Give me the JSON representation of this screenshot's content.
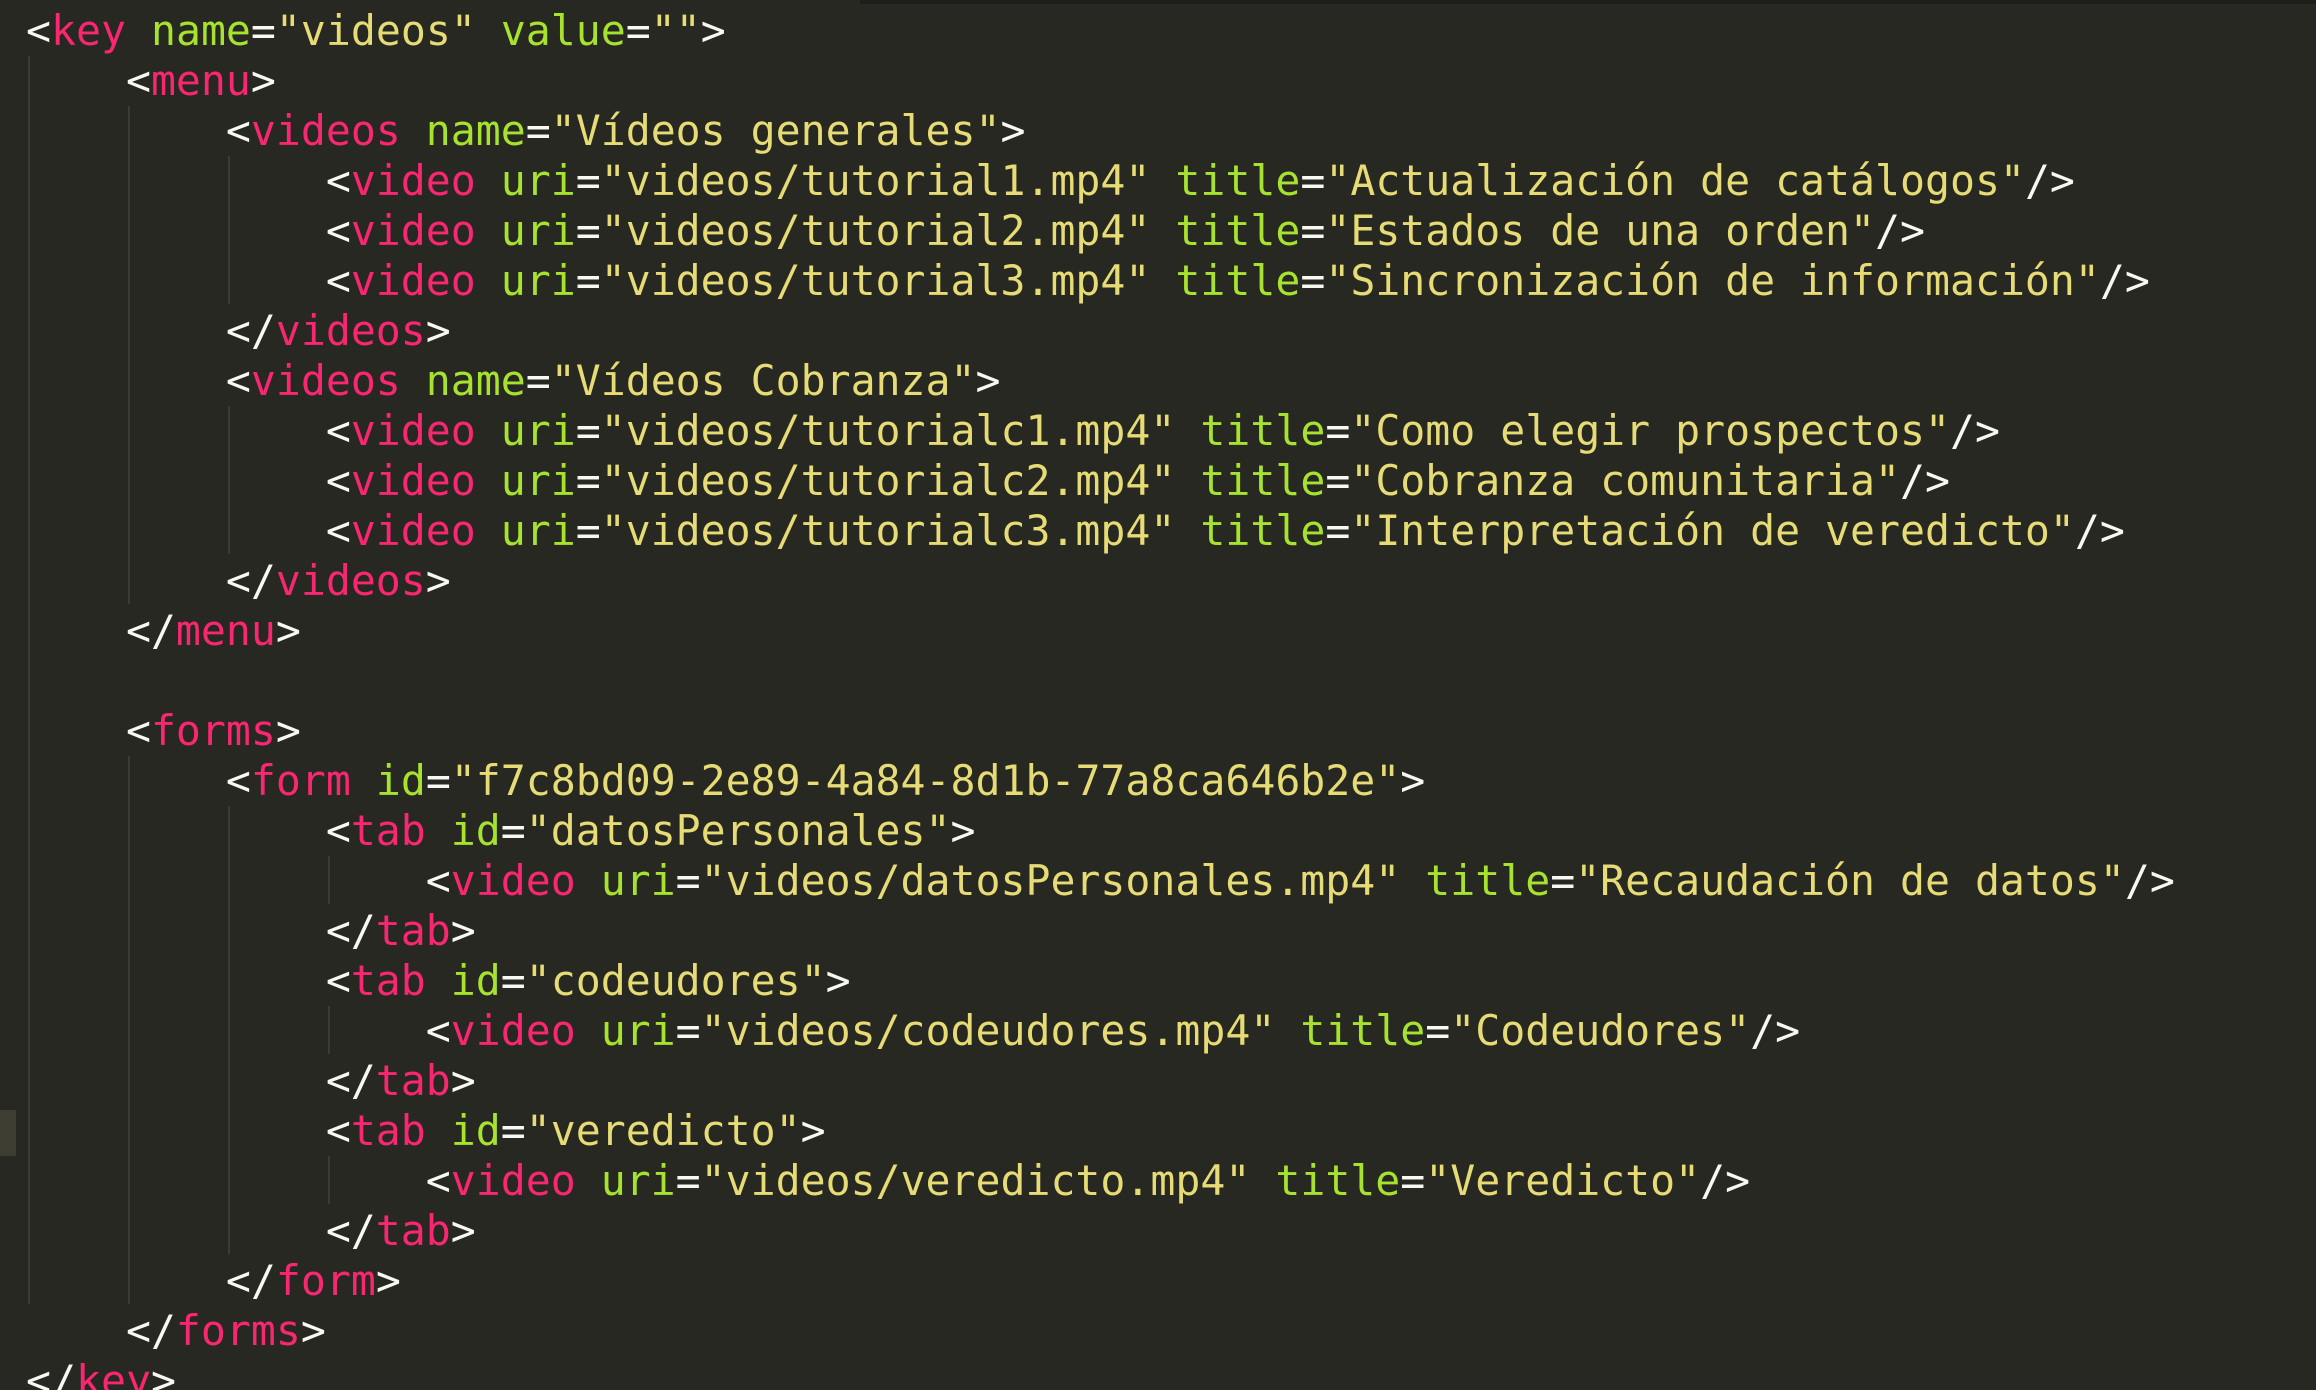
{
  "editor": {
    "theme_colors": {
      "background": "#272822",
      "tag": "#f92672",
      "attribute": "#a6e22e",
      "string": "#e6db74",
      "punctuation": "#f8f8f2"
    },
    "lines": [
      [
        {
          "k": "p",
          "v": "<"
        },
        {
          "k": "t",
          "v": "key"
        },
        {
          "k": "p",
          "v": " "
        },
        {
          "k": "a",
          "v": "name"
        },
        {
          "k": "p",
          "v": "="
        },
        {
          "k": "s",
          "v": "\"videos\""
        },
        {
          "k": "p",
          "v": " "
        },
        {
          "k": "a",
          "v": "value"
        },
        {
          "k": "p",
          "v": "="
        },
        {
          "k": "s",
          "v": "\"\""
        },
        {
          "k": "p",
          "v": ">"
        }
      ],
      [
        {
          "k": "p",
          "v": "    <"
        },
        {
          "k": "t",
          "v": "menu"
        },
        {
          "k": "p",
          "v": ">"
        }
      ],
      [
        {
          "k": "p",
          "v": "        <"
        },
        {
          "k": "t",
          "v": "videos"
        },
        {
          "k": "p",
          "v": " "
        },
        {
          "k": "a",
          "v": "name"
        },
        {
          "k": "p",
          "v": "="
        },
        {
          "k": "s",
          "v": "\"Vídeos generales\""
        },
        {
          "k": "p",
          "v": ">"
        }
      ],
      [
        {
          "k": "p",
          "v": "            <"
        },
        {
          "k": "t",
          "v": "video"
        },
        {
          "k": "p",
          "v": " "
        },
        {
          "k": "a",
          "v": "uri"
        },
        {
          "k": "p",
          "v": "="
        },
        {
          "k": "s",
          "v": "\"videos/tutorial1.mp4\""
        },
        {
          "k": "p",
          "v": " "
        },
        {
          "k": "a",
          "v": "title"
        },
        {
          "k": "p",
          "v": "="
        },
        {
          "k": "s",
          "v": "\"Actualización de catálogos\""
        },
        {
          "k": "p",
          "v": "/>"
        }
      ],
      [
        {
          "k": "p",
          "v": "            <"
        },
        {
          "k": "t",
          "v": "video"
        },
        {
          "k": "p",
          "v": " "
        },
        {
          "k": "a",
          "v": "uri"
        },
        {
          "k": "p",
          "v": "="
        },
        {
          "k": "s",
          "v": "\"videos/tutorial2.mp4\""
        },
        {
          "k": "p",
          "v": " "
        },
        {
          "k": "a",
          "v": "title"
        },
        {
          "k": "p",
          "v": "="
        },
        {
          "k": "s",
          "v": "\"Estados de una orden\""
        },
        {
          "k": "p",
          "v": "/>"
        }
      ],
      [
        {
          "k": "p",
          "v": "            <"
        },
        {
          "k": "t",
          "v": "video"
        },
        {
          "k": "p",
          "v": " "
        },
        {
          "k": "a",
          "v": "uri"
        },
        {
          "k": "p",
          "v": "="
        },
        {
          "k": "s",
          "v": "\"videos/tutorial3.mp4\""
        },
        {
          "k": "p",
          "v": " "
        },
        {
          "k": "a",
          "v": "title"
        },
        {
          "k": "p",
          "v": "="
        },
        {
          "k": "s",
          "v": "\"Sincronización de información\""
        },
        {
          "k": "p",
          "v": "/>"
        }
      ],
      [
        {
          "k": "p",
          "v": "        </"
        },
        {
          "k": "t",
          "v": "videos"
        },
        {
          "k": "p",
          "v": ">"
        }
      ],
      [
        {
          "k": "p",
          "v": "        <"
        },
        {
          "k": "t",
          "v": "videos"
        },
        {
          "k": "p",
          "v": " "
        },
        {
          "k": "a",
          "v": "name"
        },
        {
          "k": "p",
          "v": "="
        },
        {
          "k": "s",
          "v": "\"Vídeos Cobranza\""
        },
        {
          "k": "p",
          "v": ">"
        }
      ],
      [
        {
          "k": "p",
          "v": "            <"
        },
        {
          "k": "t",
          "v": "video"
        },
        {
          "k": "p",
          "v": " "
        },
        {
          "k": "a",
          "v": "uri"
        },
        {
          "k": "p",
          "v": "="
        },
        {
          "k": "s",
          "v": "\"videos/tutorialc1.mp4\""
        },
        {
          "k": "p",
          "v": " "
        },
        {
          "k": "a",
          "v": "title"
        },
        {
          "k": "p",
          "v": "="
        },
        {
          "k": "s",
          "v": "\"Como elegir prospectos\""
        },
        {
          "k": "p",
          "v": "/>"
        }
      ],
      [
        {
          "k": "p",
          "v": "            <"
        },
        {
          "k": "t",
          "v": "video"
        },
        {
          "k": "p",
          "v": " "
        },
        {
          "k": "a",
          "v": "uri"
        },
        {
          "k": "p",
          "v": "="
        },
        {
          "k": "s",
          "v": "\"videos/tutorialc2.mp4\""
        },
        {
          "k": "p",
          "v": " "
        },
        {
          "k": "a",
          "v": "title"
        },
        {
          "k": "p",
          "v": "="
        },
        {
          "k": "s",
          "v": "\"Cobranza comunitaria\""
        },
        {
          "k": "p",
          "v": "/>"
        }
      ],
      [
        {
          "k": "p",
          "v": "            <"
        },
        {
          "k": "t",
          "v": "video"
        },
        {
          "k": "p",
          "v": " "
        },
        {
          "k": "a",
          "v": "uri"
        },
        {
          "k": "p",
          "v": "="
        },
        {
          "k": "s",
          "v": "\"videos/tutorialc3.mp4\""
        },
        {
          "k": "p",
          "v": " "
        },
        {
          "k": "a",
          "v": "title"
        },
        {
          "k": "p",
          "v": "="
        },
        {
          "k": "s",
          "v": "\"Interpretación de veredicto\""
        },
        {
          "k": "p",
          "v": "/>"
        }
      ],
      [
        {
          "k": "p",
          "v": "        </"
        },
        {
          "k": "t",
          "v": "videos"
        },
        {
          "k": "p",
          "v": ">"
        }
      ],
      [
        {
          "k": "p",
          "v": "    </"
        },
        {
          "k": "t",
          "v": "menu"
        },
        {
          "k": "p",
          "v": ">"
        }
      ],
      [],
      [
        {
          "k": "p",
          "v": "    <"
        },
        {
          "k": "t",
          "v": "forms"
        },
        {
          "k": "p",
          "v": ">"
        }
      ],
      [
        {
          "k": "p",
          "v": "        <"
        },
        {
          "k": "t",
          "v": "form"
        },
        {
          "k": "p",
          "v": " "
        },
        {
          "k": "a",
          "v": "id"
        },
        {
          "k": "p",
          "v": "="
        },
        {
          "k": "s",
          "v": "\"f7c8bd09-2e89-4a84-8d1b-77a8ca646b2e\""
        },
        {
          "k": "p",
          "v": ">"
        }
      ],
      [
        {
          "k": "p",
          "v": "            <"
        },
        {
          "k": "t",
          "v": "tab"
        },
        {
          "k": "p",
          "v": " "
        },
        {
          "k": "a",
          "v": "id"
        },
        {
          "k": "p",
          "v": "="
        },
        {
          "k": "s",
          "v": "\"datosPersonales\""
        },
        {
          "k": "p",
          "v": ">"
        }
      ],
      [
        {
          "k": "p",
          "v": "                <"
        },
        {
          "k": "t",
          "v": "video"
        },
        {
          "k": "p",
          "v": " "
        },
        {
          "k": "a",
          "v": "uri"
        },
        {
          "k": "p",
          "v": "="
        },
        {
          "k": "s",
          "v": "\"videos/datosPersonales.mp4\""
        },
        {
          "k": "p",
          "v": " "
        },
        {
          "k": "a",
          "v": "title"
        },
        {
          "k": "p",
          "v": "="
        },
        {
          "k": "s",
          "v": "\"Recaudación de datos\""
        },
        {
          "k": "p",
          "v": "/>"
        }
      ],
      [
        {
          "k": "p",
          "v": "            </"
        },
        {
          "k": "t",
          "v": "tab"
        },
        {
          "k": "p",
          "v": ">"
        }
      ],
      [
        {
          "k": "p",
          "v": "            <"
        },
        {
          "k": "t",
          "v": "tab"
        },
        {
          "k": "p",
          "v": " "
        },
        {
          "k": "a",
          "v": "id"
        },
        {
          "k": "p",
          "v": "="
        },
        {
          "k": "s",
          "v": "\"codeudores\""
        },
        {
          "k": "p",
          "v": ">"
        }
      ],
      [
        {
          "k": "p",
          "v": "                <"
        },
        {
          "k": "t",
          "v": "video"
        },
        {
          "k": "p",
          "v": " "
        },
        {
          "k": "a",
          "v": "uri"
        },
        {
          "k": "p",
          "v": "="
        },
        {
          "k": "s",
          "v": "\"videos/codeudores.mp4\""
        },
        {
          "k": "p",
          "v": " "
        },
        {
          "k": "a",
          "v": "title"
        },
        {
          "k": "p",
          "v": "="
        },
        {
          "k": "s",
          "v": "\"Codeudores\""
        },
        {
          "k": "p",
          "v": "/>"
        }
      ],
      [
        {
          "k": "p",
          "v": "            </"
        },
        {
          "k": "t",
          "v": "tab"
        },
        {
          "k": "p",
          "v": ">"
        }
      ],
      [
        {
          "k": "p",
          "v": "            <"
        },
        {
          "k": "t",
          "v": "tab"
        },
        {
          "k": "p",
          "v": " "
        },
        {
          "k": "a",
          "v": "id"
        },
        {
          "k": "p",
          "v": "="
        },
        {
          "k": "s",
          "v": "\"veredicto\""
        },
        {
          "k": "p",
          "v": ">"
        }
      ],
      [
        {
          "k": "p",
          "v": "                <"
        },
        {
          "k": "t",
          "v": "video"
        },
        {
          "k": "p",
          "v": " "
        },
        {
          "k": "a",
          "v": "uri"
        },
        {
          "k": "p",
          "v": "="
        },
        {
          "k": "s",
          "v": "\"videos/veredicto.mp4\""
        },
        {
          "k": "p",
          "v": " "
        },
        {
          "k": "a",
          "v": "title"
        },
        {
          "k": "p",
          "v": "="
        },
        {
          "k": "s",
          "v": "\"Veredicto\""
        },
        {
          "k": "p",
          "v": "/>"
        }
      ],
      [
        {
          "k": "p",
          "v": "            </"
        },
        {
          "k": "t",
          "v": "tab"
        },
        {
          "k": "p",
          "v": ">"
        }
      ],
      [
        {
          "k": "p",
          "v": "        </"
        },
        {
          "k": "t",
          "v": "form"
        },
        {
          "k": "p",
          "v": ">"
        }
      ],
      [
        {
          "k": "p",
          "v": "    </"
        },
        {
          "k": "t",
          "v": "forms"
        },
        {
          "k": "p",
          "v": ">"
        }
      ],
      [
        {
          "k": "p",
          "v": "</"
        },
        {
          "k": "t",
          "v": "key"
        },
        {
          "k": "p",
          "v": ">"
        }
      ]
    ]
  }
}
